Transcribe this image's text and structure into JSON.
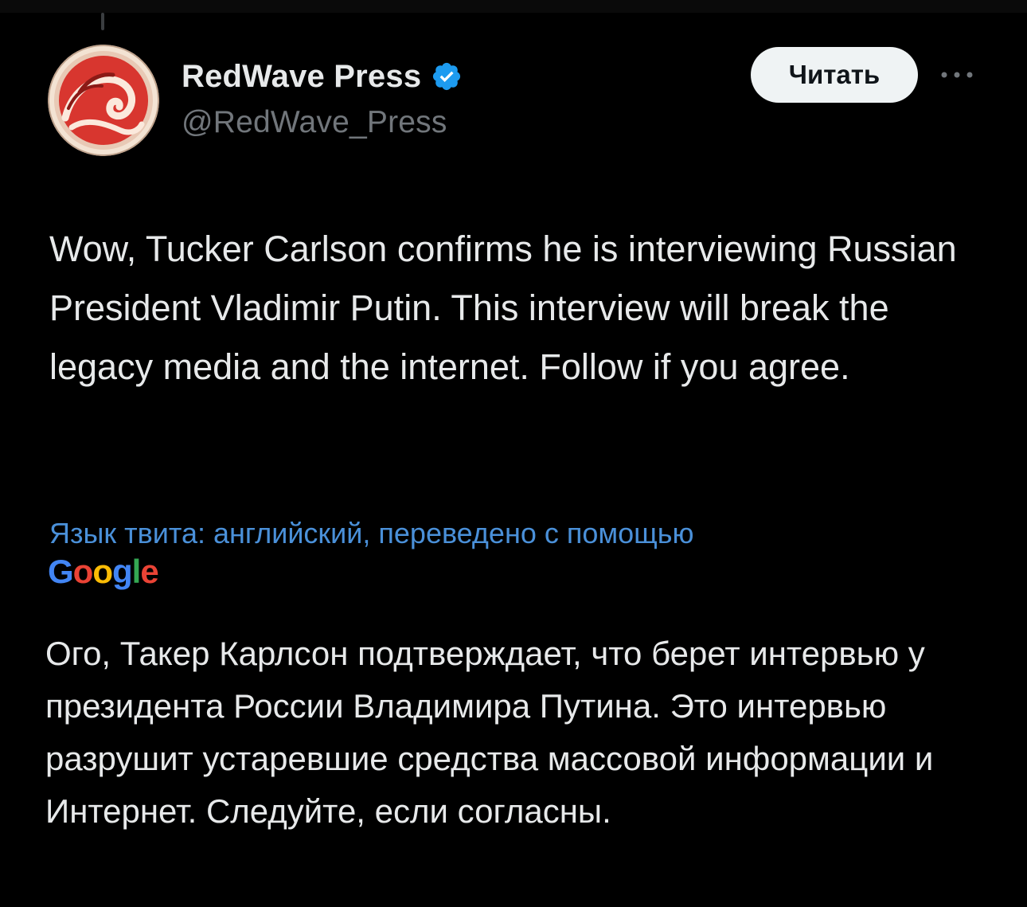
{
  "tweet": {
    "author": {
      "display_name": "RedWave Press",
      "handle": "@RedWave_Press",
      "verified": true,
      "avatar_icon": "red-wave-logo-icon"
    },
    "follow_label": "Читать",
    "more_icon": "more-horizontal-icon",
    "text": "Wow, Tucker Carlson confirms he is interviewing Russian President Vladimir Putin. This interview will break the legacy media and the internet. Follow if you agree.",
    "translation": {
      "note": "Язык твита: английский, переведено с помощью",
      "provider": "Google",
      "text": "Ого, Такер Карлсон подтверждает, что берет интервью у президента России Владимира Путина. Это интервью разрушит устаревшие средства массовой информации и Интернет. Следуйте, если согласны."
    }
  },
  "colors": {
    "background": "#000000",
    "text_primary": "#e7e9ea",
    "text_secondary": "#71767b",
    "link_blue": "#4a90d9",
    "verified_blue": "#1d9bf0",
    "button_bg": "#eff3f4",
    "google_blue": "#4285F4",
    "google_red": "#EA4335",
    "google_yellow": "#FBBC05",
    "google_green": "#34A853"
  }
}
